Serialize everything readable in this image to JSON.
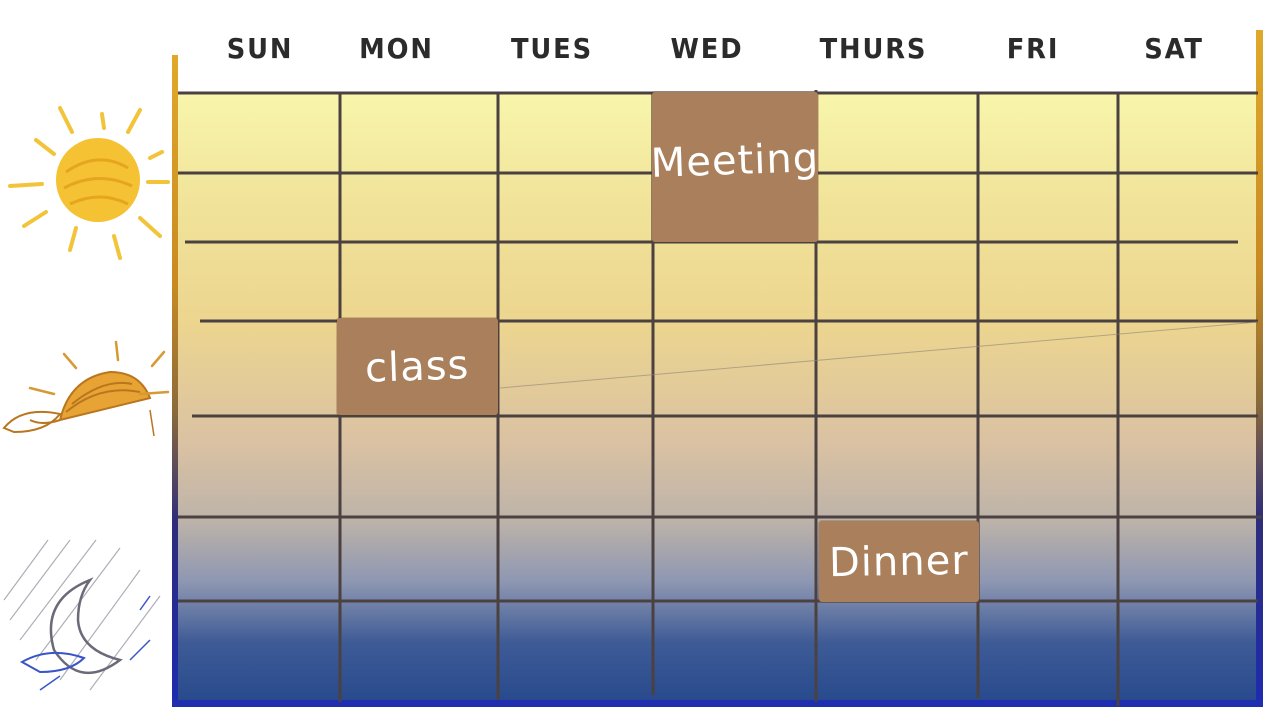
{
  "calendar": {
    "days": [
      "SUN",
      "MON",
      "TUES",
      "WED",
      "THURS",
      "FRI",
      "SAT"
    ],
    "events": {
      "meeting": "Meeting",
      "class": "class",
      "dinner": "Dinner"
    }
  },
  "icons": {
    "morning": "sun-icon",
    "evening": "setting-sun-icon",
    "night": "moon-rain-icon"
  },
  "colors": {
    "background_top": "#f7f4a8",
    "background_mid": "#d8c39a",
    "background_bottom": "#27498c",
    "grid_line": "#4a3f3f",
    "event_block": "#a97f5c",
    "frame_top": "#d6a21a",
    "frame_bottom": "#1e2fa6"
  }
}
